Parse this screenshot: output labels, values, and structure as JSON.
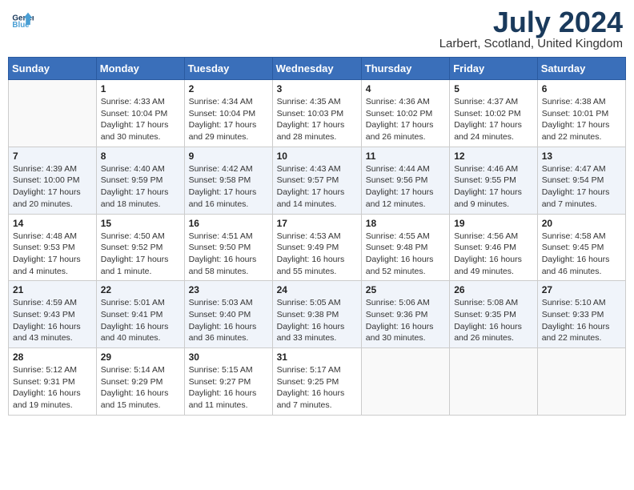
{
  "header": {
    "logo_text_general": "General",
    "logo_text_blue": "Blue",
    "month_title": "July 2024",
    "location": "Larbert, Scotland, United Kingdom"
  },
  "days_of_week": [
    "Sunday",
    "Monday",
    "Tuesday",
    "Wednesday",
    "Thursday",
    "Friday",
    "Saturday"
  ],
  "weeks": [
    [
      {
        "num": "",
        "info": ""
      },
      {
        "num": "1",
        "info": "Sunrise: 4:33 AM\nSunset: 10:04 PM\nDaylight: 17 hours\nand 30 minutes."
      },
      {
        "num": "2",
        "info": "Sunrise: 4:34 AM\nSunset: 10:04 PM\nDaylight: 17 hours\nand 29 minutes."
      },
      {
        "num": "3",
        "info": "Sunrise: 4:35 AM\nSunset: 10:03 PM\nDaylight: 17 hours\nand 28 minutes."
      },
      {
        "num": "4",
        "info": "Sunrise: 4:36 AM\nSunset: 10:02 PM\nDaylight: 17 hours\nand 26 minutes."
      },
      {
        "num": "5",
        "info": "Sunrise: 4:37 AM\nSunset: 10:02 PM\nDaylight: 17 hours\nand 24 minutes."
      },
      {
        "num": "6",
        "info": "Sunrise: 4:38 AM\nSunset: 10:01 PM\nDaylight: 17 hours\nand 22 minutes."
      }
    ],
    [
      {
        "num": "7",
        "info": "Sunrise: 4:39 AM\nSunset: 10:00 PM\nDaylight: 17 hours\nand 20 minutes."
      },
      {
        "num": "8",
        "info": "Sunrise: 4:40 AM\nSunset: 9:59 PM\nDaylight: 17 hours\nand 18 minutes."
      },
      {
        "num": "9",
        "info": "Sunrise: 4:42 AM\nSunset: 9:58 PM\nDaylight: 17 hours\nand 16 minutes."
      },
      {
        "num": "10",
        "info": "Sunrise: 4:43 AM\nSunset: 9:57 PM\nDaylight: 17 hours\nand 14 minutes."
      },
      {
        "num": "11",
        "info": "Sunrise: 4:44 AM\nSunset: 9:56 PM\nDaylight: 17 hours\nand 12 minutes."
      },
      {
        "num": "12",
        "info": "Sunrise: 4:46 AM\nSunset: 9:55 PM\nDaylight: 17 hours\nand 9 minutes."
      },
      {
        "num": "13",
        "info": "Sunrise: 4:47 AM\nSunset: 9:54 PM\nDaylight: 17 hours\nand 7 minutes."
      }
    ],
    [
      {
        "num": "14",
        "info": "Sunrise: 4:48 AM\nSunset: 9:53 PM\nDaylight: 17 hours\nand 4 minutes."
      },
      {
        "num": "15",
        "info": "Sunrise: 4:50 AM\nSunset: 9:52 PM\nDaylight: 17 hours\nand 1 minute."
      },
      {
        "num": "16",
        "info": "Sunrise: 4:51 AM\nSunset: 9:50 PM\nDaylight: 16 hours\nand 58 minutes."
      },
      {
        "num": "17",
        "info": "Sunrise: 4:53 AM\nSunset: 9:49 PM\nDaylight: 16 hours\nand 55 minutes."
      },
      {
        "num": "18",
        "info": "Sunrise: 4:55 AM\nSunset: 9:48 PM\nDaylight: 16 hours\nand 52 minutes."
      },
      {
        "num": "19",
        "info": "Sunrise: 4:56 AM\nSunset: 9:46 PM\nDaylight: 16 hours\nand 49 minutes."
      },
      {
        "num": "20",
        "info": "Sunrise: 4:58 AM\nSunset: 9:45 PM\nDaylight: 16 hours\nand 46 minutes."
      }
    ],
    [
      {
        "num": "21",
        "info": "Sunrise: 4:59 AM\nSunset: 9:43 PM\nDaylight: 16 hours\nand 43 minutes."
      },
      {
        "num": "22",
        "info": "Sunrise: 5:01 AM\nSunset: 9:41 PM\nDaylight: 16 hours\nand 40 minutes."
      },
      {
        "num": "23",
        "info": "Sunrise: 5:03 AM\nSunset: 9:40 PM\nDaylight: 16 hours\nand 36 minutes."
      },
      {
        "num": "24",
        "info": "Sunrise: 5:05 AM\nSunset: 9:38 PM\nDaylight: 16 hours\nand 33 minutes."
      },
      {
        "num": "25",
        "info": "Sunrise: 5:06 AM\nSunset: 9:36 PM\nDaylight: 16 hours\nand 30 minutes."
      },
      {
        "num": "26",
        "info": "Sunrise: 5:08 AM\nSunset: 9:35 PM\nDaylight: 16 hours\nand 26 minutes."
      },
      {
        "num": "27",
        "info": "Sunrise: 5:10 AM\nSunset: 9:33 PM\nDaylight: 16 hours\nand 22 minutes."
      }
    ],
    [
      {
        "num": "28",
        "info": "Sunrise: 5:12 AM\nSunset: 9:31 PM\nDaylight: 16 hours\nand 19 minutes."
      },
      {
        "num": "29",
        "info": "Sunrise: 5:14 AM\nSunset: 9:29 PM\nDaylight: 16 hours\nand 15 minutes."
      },
      {
        "num": "30",
        "info": "Sunrise: 5:15 AM\nSunset: 9:27 PM\nDaylight: 16 hours\nand 11 minutes."
      },
      {
        "num": "31",
        "info": "Sunrise: 5:17 AM\nSunset: 9:25 PM\nDaylight: 16 hours\nand 7 minutes."
      },
      {
        "num": "",
        "info": ""
      },
      {
        "num": "",
        "info": ""
      },
      {
        "num": "",
        "info": ""
      }
    ]
  ]
}
